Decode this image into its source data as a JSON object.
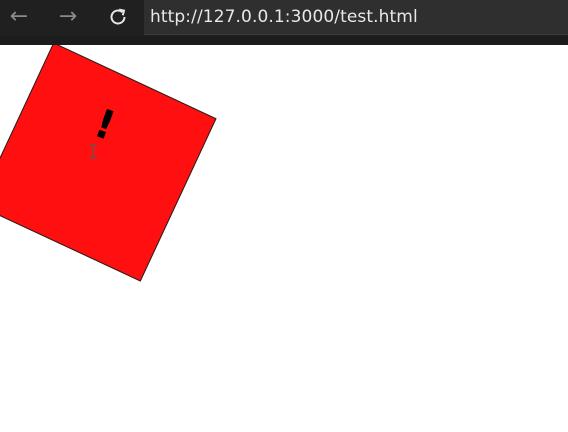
{
  "browser": {
    "back_icon": "arrow-left-icon",
    "forward_icon": "arrow-right-icon",
    "reload_icon": "reload-icon",
    "url": "http://127.0.0.1:3000/test.html"
  },
  "page": {
    "box_color": "#ff0f0f",
    "box_text": "!"
  }
}
